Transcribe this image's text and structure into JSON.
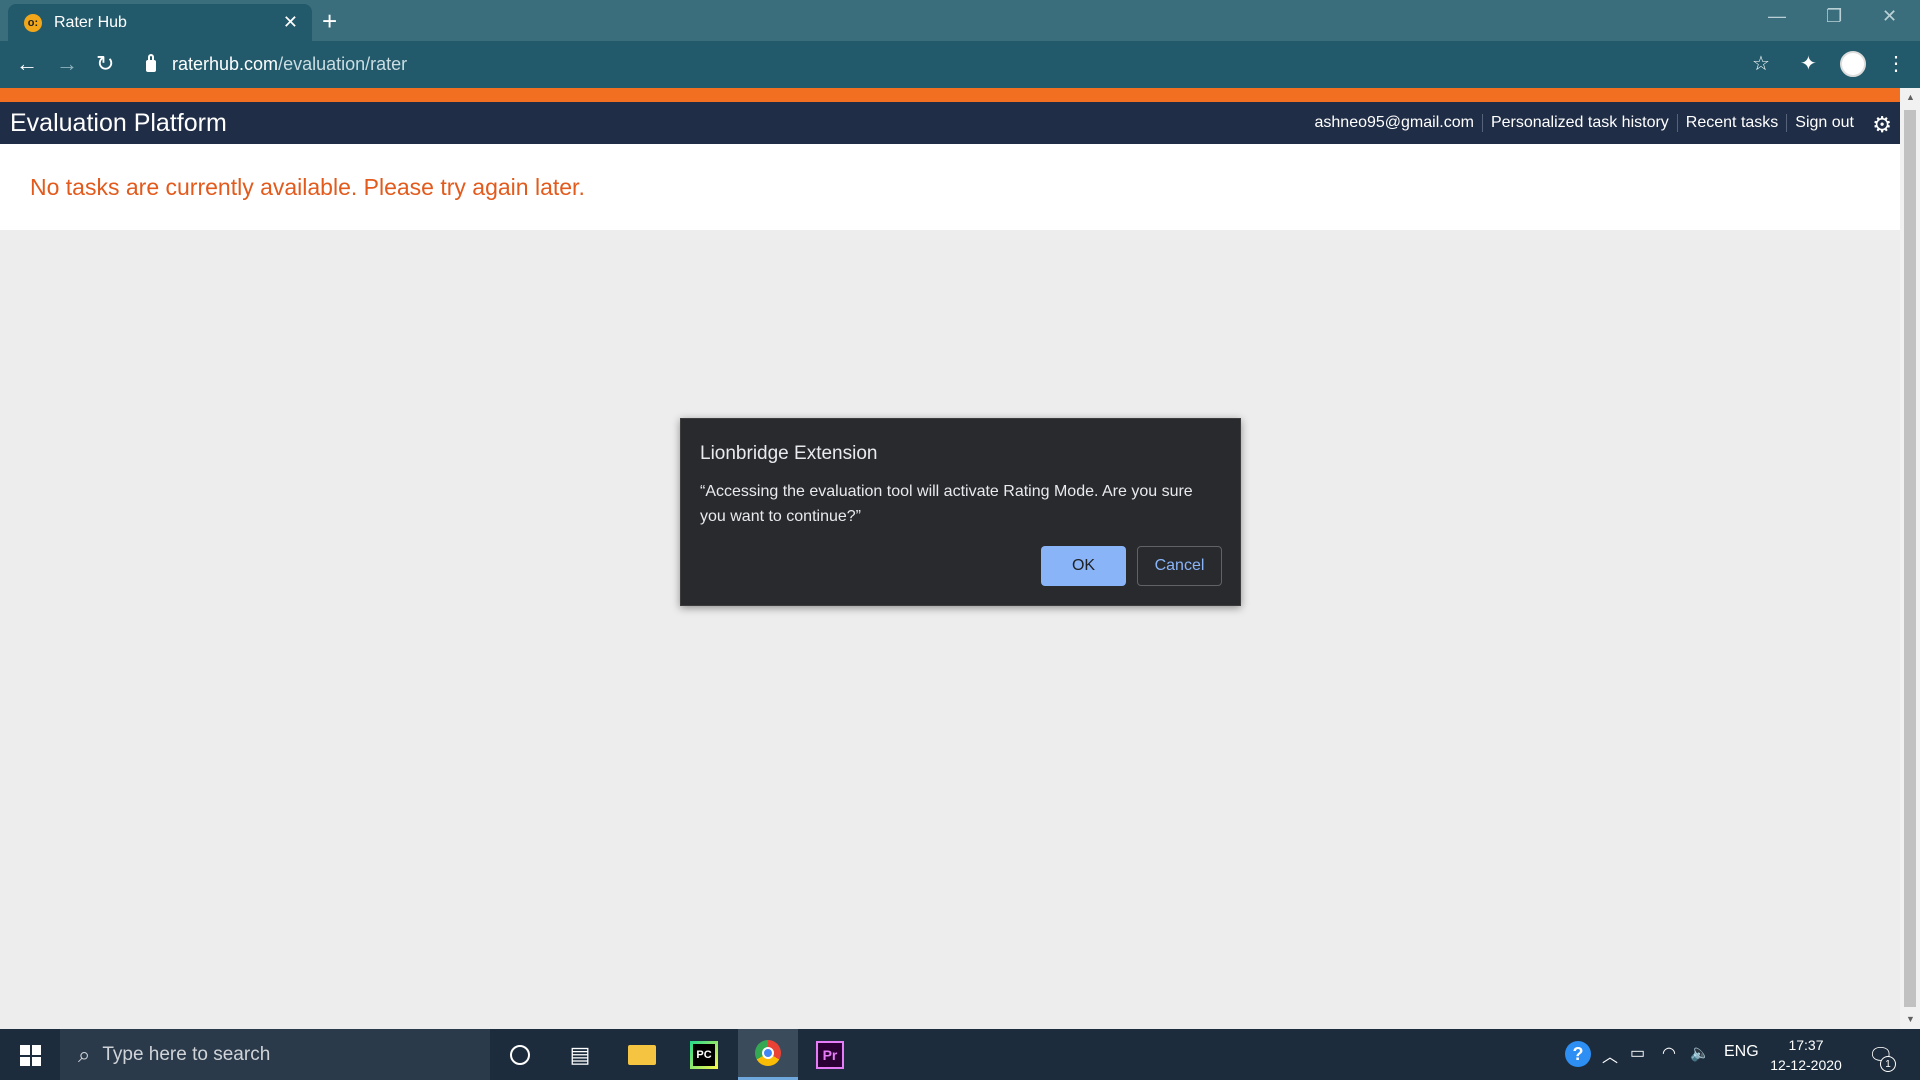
{
  "browser": {
    "tab_title": "Rater Hub",
    "favicon_text": "o:",
    "url_host": "raterhub.com",
    "url_path": "/evaluation/rater"
  },
  "header": {
    "title": "Evaluation Platform",
    "links": [
      "ashneo95@gmail.com",
      "Personalized task history",
      "Recent tasks",
      "Sign out"
    ]
  },
  "notice": "No tasks are currently available. Please try again later.",
  "dialog": {
    "title": "Lionbridge Extension",
    "message": "“Accessing the evaluation tool will activate Rating Mode. Are you sure you want to continue?”",
    "ok_label": "OK",
    "cancel_label": "Cancel"
  },
  "taskbar": {
    "search_placeholder": "Type here to search",
    "pycharm_label": "PC",
    "premiere_label": "Pr",
    "language": "ENG",
    "time": "17:37",
    "date": "12-12-2020",
    "notification_count": "1"
  },
  "colors": {
    "accent_orange": "#f26f22",
    "header_navy": "#1f2d46",
    "notice_red": "#e25a1c",
    "dialog_bg": "#292a2d",
    "ok_blue": "#8ab4f8"
  },
  "icons": [
    "back-icon",
    "forward-icon",
    "reload-icon",
    "lock-icon",
    "star-icon",
    "extensions-icon",
    "menu-icon",
    "gear-icon",
    "windows-start-icon",
    "search-icon",
    "cortana-icon",
    "task-view-icon",
    "file-explorer-icon",
    "pycharm-icon",
    "chrome-icon",
    "premiere-icon",
    "help-icon",
    "notification-icon"
  ]
}
